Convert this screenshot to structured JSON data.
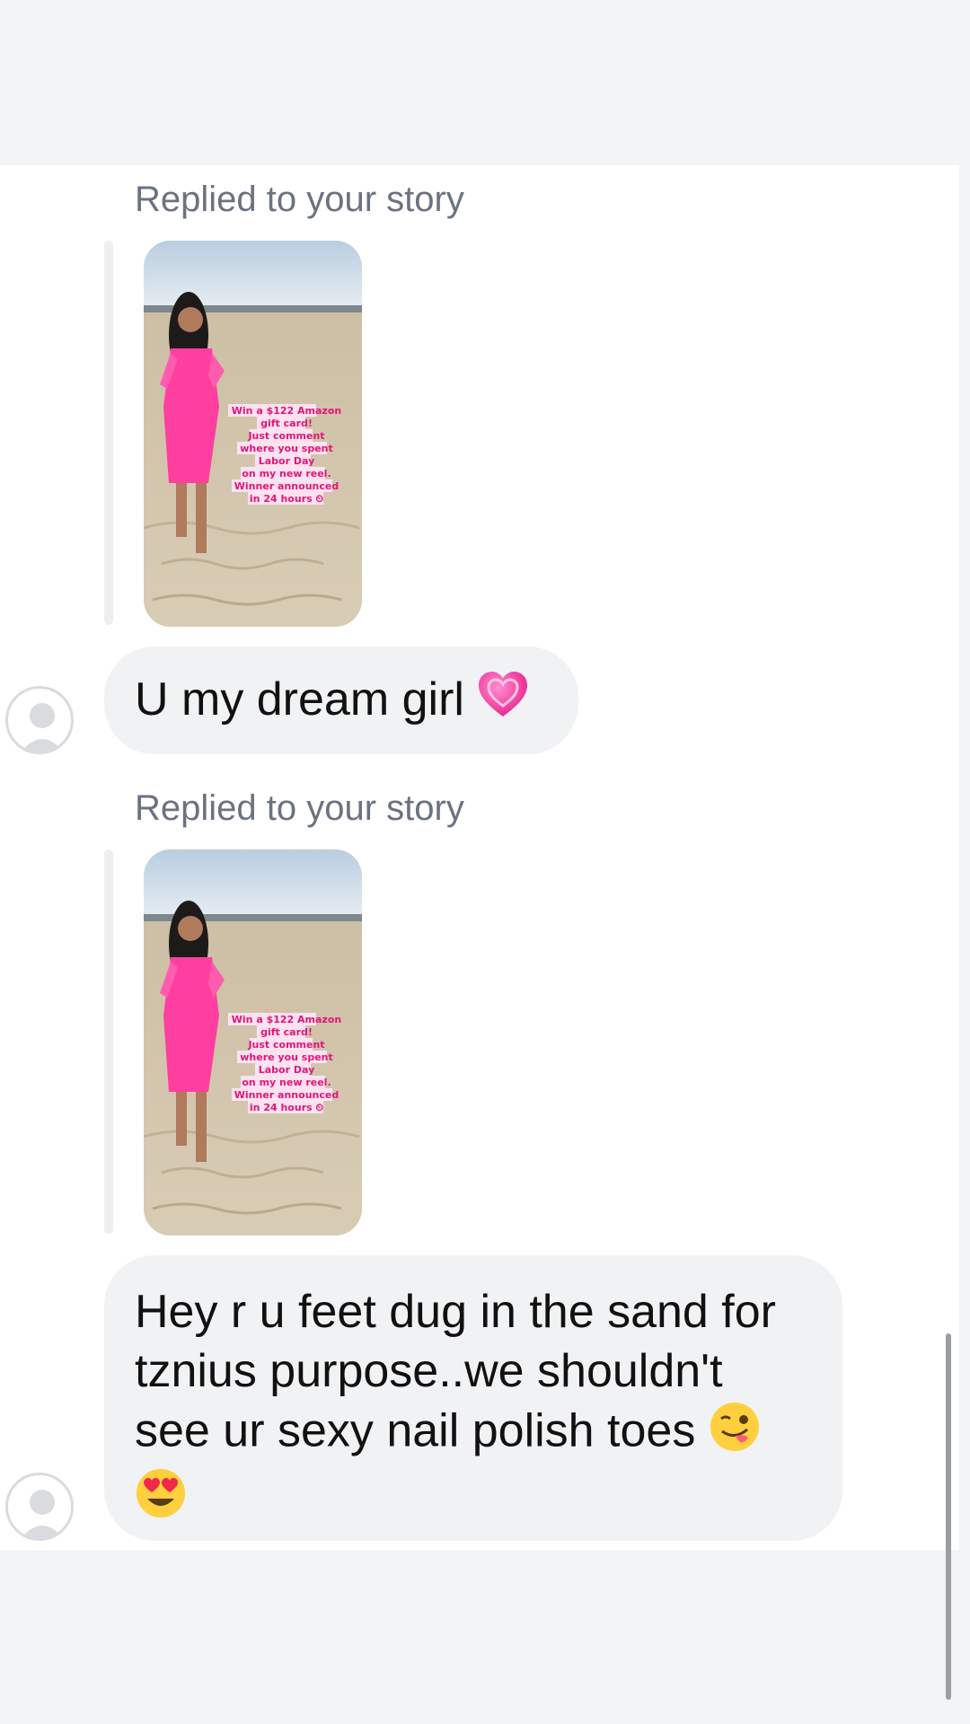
{
  "messages": [
    {
      "reply_label": "Replied to your story",
      "story_caption": [
        "Win a $122 Amazon",
        "gift card!",
        "Just comment",
        "where you spent",
        "Labor Day",
        "on my new reel.",
        "Winner announced",
        "in 24 hours ⏲"
      ],
      "text": "U my dream girl",
      "emoji": "pink-heart-emoji"
    },
    {
      "reply_label": "Replied to your story",
      "story_caption": [
        "Win a $122 Amazon",
        "gift card!",
        "Just comment",
        "where you spent",
        "Labor Day",
        "on my new reel.",
        "Winner announced",
        "in 24 hours ⏲"
      ],
      "text_lines": [
        "Hey r u feet dug in the sand for",
        "tznius purpose..we shouldn't",
        "see ur sexy nail polish toes"
      ],
      "emoji": [
        "winking-tongue-emoji",
        "heart-eyes-emoji"
      ]
    }
  ],
  "colors": {
    "bubble": "#f1f2f4",
    "label": "#6b7280",
    "dress": "#ff3fa0"
  }
}
